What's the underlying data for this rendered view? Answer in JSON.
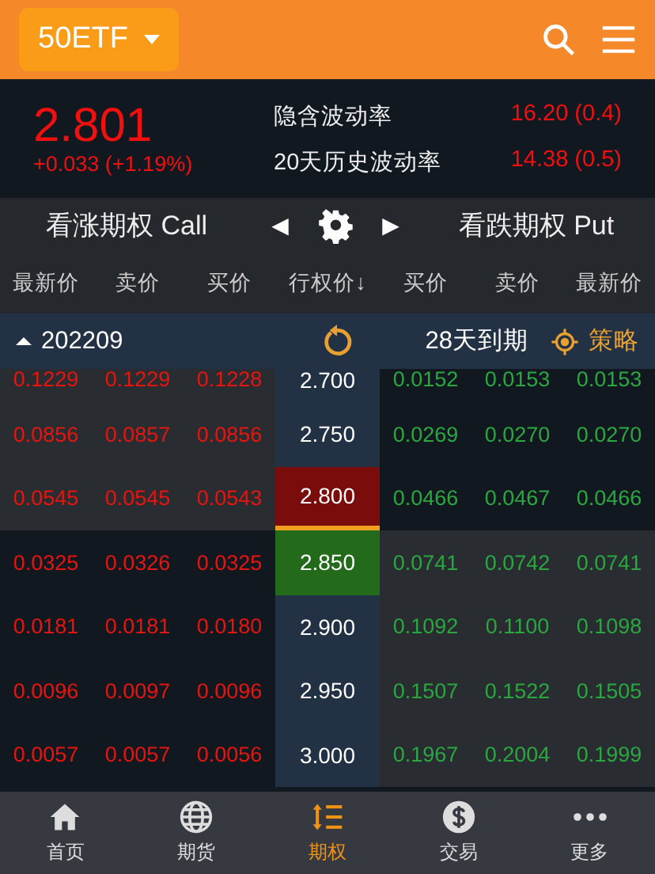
{
  "header": {
    "symbol": "50ETF"
  },
  "quote": {
    "price": "2.801",
    "change": "+0.033 (+1.19%)",
    "stats": [
      {
        "label": "隐含波动率",
        "value": "16.20 (0.4)"
      },
      {
        "label": "20天历史波动率",
        "value": "14.38 (0.5)"
      }
    ]
  },
  "option_bar": {
    "call_label": "看涨期权 Call",
    "prev": "◀",
    "next": "▶",
    "put_label": "看跌期权 Put"
  },
  "columns": [
    "最新价",
    "卖价",
    "买价",
    "行权价↓",
    "买价",
    "卖价",
    "最新价"
  ],
  "expiry": {
    "month": "202209",
    "days": "28天到期",
    "strategy": "策略"
  },
  "rows": [
    {
      "call": [
        "0.1229",
        "0.1229",
        "0.1228"
      ],
      "strike": "2.700",
      "put": [
        "0.0152",
        "0.0153",
        "0.0153"
      ],
      "call_in_money": true,
      "put_in_money": false,
      "partial": true
    },
    {
      "call": [
        "0.0856",
        "0.0857",
        "0.0856"
      ],
      "strike": "2.750",
      "put": [
        "0.0269",
        "0.0270",
        "0.0270"
      ],
      "call_in_money": true,
      "put_in_money": false
    },
    {
      "call": [
        "0.0545",
        "0.0545",
        "0.0543"
      ],
      "strike": "2.800",
      "put": [
        "0.0466",
        "0.0467",
        "0.0466"
      ],
      "call_in_money": true,
      "put_in_money": false,
      "color": "#7a0c0c"
    },
    {
      "call": [
        "0.0325",
        "0.0326",
        "0.0325"
      ],
      "strike": "2.850",
      "put": [
        "0.0741",
        "0.0742",
        "0.0741"
      ],
      "call_in_money": false,
      "put_in_money": true,
      "color": "#236b1a"
    },
    {
      "call": [
        "0.0181",
        "0.0181",
        "0.0180"
      ],
      "strike": "2.900",
      "put": [
        "0.1092",
        "0.1100",
        "0.1098"
      ],
      "call_in_money": false,
      "put_in_money": true
    },
    {
      "call": [
        "0.0096",
        "0.0097",
        "0.0096"
      ],
      "strike": "2.950",
      "put": [
        "0.1507",
        "0.1522",
        "0.1505"
      ],
      "call_in_money": false,
      "put_in_money": true
    },
    {
      "call": [
        "0.0057",
        "0.0057",
        "0.0056"
      ],
      "strike": "3.000",
      "put": [
        "0.1967",
        "0.2004",
        "0.1999"
      ],
      "call_in_money": false,
      "put_in_money": true
    }
  ],
  "nav": [
    {
      "label": "首页",
      "kind": "home",
      "selected": false
    },
    {
      "label": "期货",
      "kind": "globe",
      "selected": false
    },
    {
      "label": "期权",
      "kind": "sort",
      "selected": true
    },
    {
      "label": "交易",
      "kind": "dollar",
      "selected": false
    },
    {
      "label": "更多",
      "kind": "more",
      "selected": false
    }
  ]
}
